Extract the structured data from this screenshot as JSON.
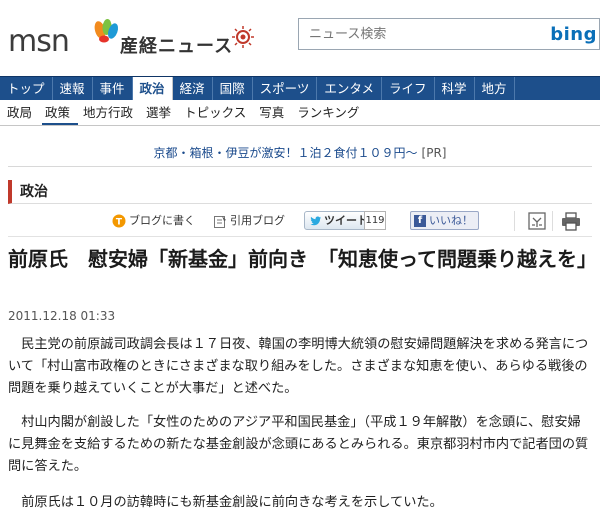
{
  "header": {
    "msn_logo": "msn",
    "site_name": "産経ニュース",
    "search_placeholder": "ニュース検索",
    "search_engine": "bing"
  },
  "nav_main": [
    {
      "label": "トップ"
    },
    {
      "label": "速報"
    },
    {
      "label": "事件"
    },
    {
      "label": "政治",
      "active": true
    },
    {
      "label": "経済"
    },
    {
      "label": "国際"
    },
    {
      "label": "スポーツ"
    },
    {
      "label": "エンタメ"
    },
    {
      "label": "ライフ"
    },
    {
      "label": "科学"
    },
    {
      "label": "地方"
    }
  ],
  "nav_sub": [
    {
      "label": "政局"
    },
    {
      "label": "政策",
      "active": true
    },
    {
      "label": "地方行政"
    },
    {
      "label": "選挙"
    },
    {
      "label": "トピックス"
    },
    {
      "label": "写真"
    },
    {
      "label": "ランキング"
    }
  ],
  "promo": {
    "text": "京都・箱根・伊豆が激安！１泊２食付１０９円〜",
    "tag": "[PR]"
  },
  "section": {
    "title": "政治"
  },
  "toolbar": {
    "blog_write": "ブログに書く",
    "quote_blog": "引用ブログ",
    "tweet": "ツイート",
    "tweet_count": "119",
    "like": "いいね！",
    "icon_bookmark": "bookmark-icon",
    "icon_print": "print-icon",
    "accent_blog": "#f39800",
    "accent_facebook": "#3b5998"
  },
  "article": {
    "headline": "前原氏　慰安婦「新基金」前向き　「知恵使って問題乗り越えを」",
    "timestamp": "2011.12.18 01:33",
    "paragraphs": [
      "民主党の前原誠司政調会長は１７日夜、韓国の李明博大統領の慰安婦問題解決を求める発言について「村山富市政権のときにさまざまな取り組みをした。さまざまな知恵を使い、あらゆる戦後の問題を乗り越えていくことが大事だ」と述べた。",
      "村山内閣が創設した「女性のためのアジア平和国民基金」（平成１９年解散）を念頭に、慰安婦に見舞金を支給するための新たな基金創設が念頭にあるとみられる。東京都羽村市内で記者団の質問に答えた。",
      "前原氏は１０月の訪韓時にも新基金創設に前向きな考えを示していた。"
    ]
  },
  "colors": {
    "nav_bg": "#1d4f8b",
    "section_accent": "#c0392b",
    "link": "#1a4a8c"
  }
}
